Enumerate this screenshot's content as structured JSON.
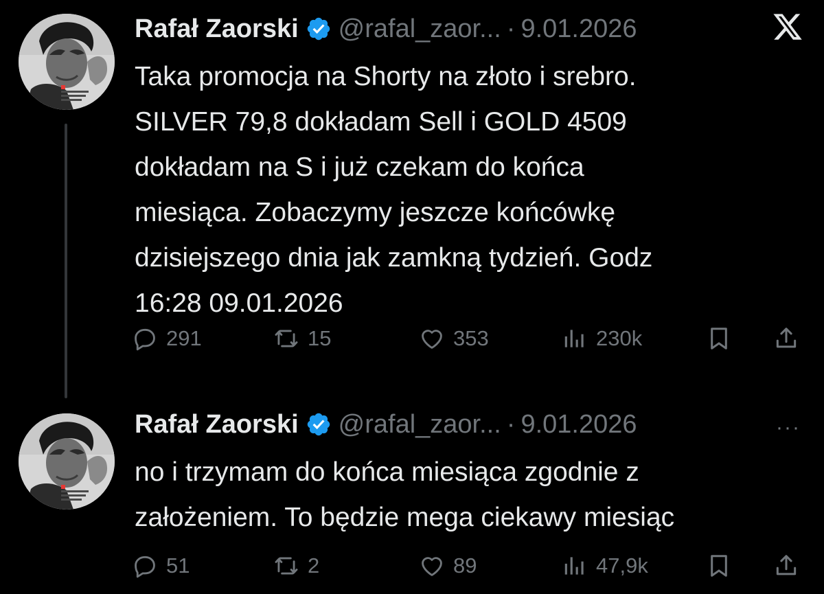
{
  "colors": {
    "background": "#000000",
    "text": "#e7e9ea",
    "muted": "#71767b",
    "verified": "#1d9bf0"
  },
  "tweets": [
    {
      "name": "Rafał Zaorski",
      "handle": "@rafal_zaor...",
      "separator": "·",
      "date": "9.01.2026",
      "corner_icon": "x-logo-icon",
      "lines": [
        "Taka promocja na Shorty  na złoto i srebro.",
        "SILVER 79,8 dokładam Sell i GOLD 4509",
        "dokładam na S i już czekam do końca",
        "miesiąca. Zobaczymy jeszcze końcówkę",
        "dzisiejszego dnia jak zamkną tydzień. Godz",
        "16:28 09.01.2026"
      ],
      "stats": {
        "replies": "291",
        "retweets": "15",
        "likes": "353",
        "views": "230k"
      }
    },
    {
      "name": "Rafał Zaorski",
      "handle": "@rafal_zaor...",
      "separator": "·",
      "date": "9.01.2026",
      "corner_icon": "more-icon",
      "more": "···",
      "lines": [
        "no i trzymam do końca miesiąca zgodnie z",
        "założeniem. To będzie mega ciekawy miesiąc"
      ],
      "stats": {
        "replies": "51",
        "retweets": "2",
        "likes": "89",
        "views": "47,9k"
      }
    }
  ]
}
